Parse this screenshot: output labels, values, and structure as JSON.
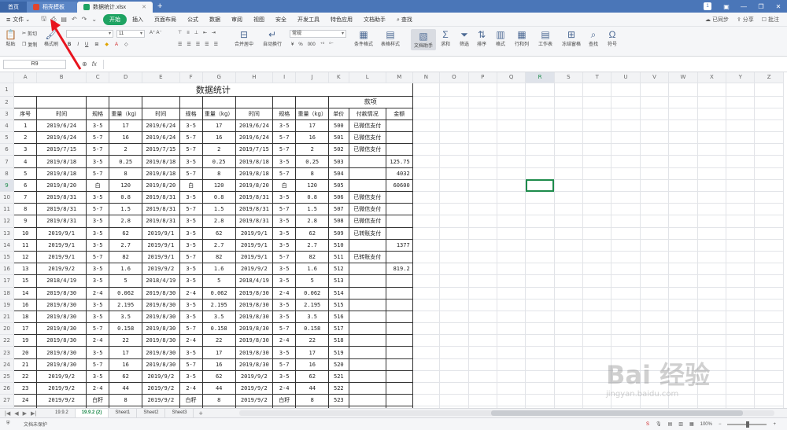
{
  "titlebar": {
    "home_tab": "首页",
    "template_tab": "稻壳模板",
    "file_tab": "数据统计.xlsx",
    "badge": "1"
  },
  "menubar": {
    "file_label": "文件",
    "items": [
      "开始",
      "插入",
      "页面布局",
      "公式",
      "数据",
      "审阅",
      "视图",
      "安全",
      "开发工具",
      "特色应用",
      "文档助手",
      "查找"
    ],
    "right": [
      "已同步",
      "分享",
      "批注"
    ]
  },
  "ribbon": {
    "cut": "剪切",
    "paste": "粘贴",
    "copy": "复制",
    "format_painter": "格式刷",
    "font_size": "11",
    "merge_center": "合并居中",
    "wrap": "自动换行",
    "number_format": "常规",
    "cond_format": "条件格式",
    "table_style": "表格样式",
    "doc_helper": "文档助手",
    "sum": "求和",
    "filter": "筛选",
    "sort": "排序",
    "format": "格式",
    "row_col": "行和列",
    "worksheet": "工作表",
    "freeze": "冻结窗格",
    "find": "查找",
    "symbol": "符号"
  },
  "formulabar": {
    "namebox": "R9",
    "fx": "fx"
  },
  "sheet": {
    "columns": [
      "A",
      "B",
      "C",
      "D",
      "E",
      "F",
      "G",
      "H",
      "I",
      "J",
      "K",
      "L",
      "M",
      "N",
      "O",
      "P",
      "Q",
      "R",
      "S",
      "T",
      "U",
      "V",
      "W",
      "X",
      "Y",
      "Z"
    ],
    "title": "数据统计",
    "kuanxiang": "款项",
    "headers": [
      "序号",
      "时间",
      "规格",
      "重量（kg）",
      "时间",
      "规格",
      "重量（kg）",
      "时间",
      "规格",
      "重量（kg）",
      "单价",
      "付款情况",
      "金额"
    ],
    "rows": [
      {
        "rn": "4",
        "c": [
          "1",
          "2019/6/24",
          "3-5",
          "17",
          "2019/6/24",
          "3-5",
          "17",
          "2019/6/24",
          "3-5",
          "17",
          "500",
          "已微信支付",
          ""
        ]
      },
      {
        "rn": "5",
        "c": [
          "2",
          "2019/6/24",
          "5-7",
          "16",
          "2019/6/24",
          "5-7",
          "16",
          "2019/6/24",
          "5-7",
          "16",
          "501",
          "已微信支付",
          ""
        ]
      },
      {
        "rn": "6",
        "c": [
          "3",
          "2019/7/15",
          "5-7",
          "2",
          "2019/7/15",
          "5-7",
          "2",
          "2019/7/15",
          "5-7",
          "2",
          "502",
          "已微信支付",
          ""
        ]
      },
      {
        "rn": "7",
        "c": [
          "4",
          "2019/8/18",
          "3-5",
          "0.25",
          "2019/8/18",
          "3-5",
          "0.25",
          "2019/8/18",
          "3-5",
          "0.25",
          "503",
          "",
          "125.75"
        ]
      },
      {
        "rn": "8",
        "c": [
          "5",
          "2019/8/18",
          "5-7",
          "8",
          "2019/8/18",
          "5-7",
          "8",
          "2019/8/18",
          "5-7",
          "8",
          "504",
          "",
          "4032"
        ]
      },
      {
        "rn": "9",
        "c": [
          "6",
          "2019/8/20",
          "白",
          "120",
          "2019/8/20",
          "白",
          "120",
          "2019/8/20",
          "白",
          "120",
          "505",
          "",
          "60600"
        ]
      },
      {
        "rn": "10",
        "c": [
          "7",
          "2019/8/31",
          "3-5",
          "0.8",
          "2019/8/31",
          "3-5",
          "0.8",
          "2019/8/31",
          "3-5",
          "0.8",
          "506",
          "已微信支付",
          ""
        ]
      },
      {
        "rn": "11",
        "c": [
          "8",
          "2019/8/31",
          "5-7",
          "1.5",
          "2019/8/31",
          "5-7",
          "1.5",
          "2019/8/31",
          "5-7",
          "1.5",
          "507",
          "已微信支付",
          ""
        ]
      },
      {
        "rn": "12",
        "c": [
          "9",
          "2019/8/31",
          "3-5",
          "2.8",
          "2019/8/31",
          "3-5",
          "2.8",
          "2019/8/31",
          "3-5",
          "2.8",
          "508",
          "已微信支付",
          ""
        ]
      },
      {
        "rn": "13",
        "c": [
          "10",
          "2019/9/1",
          "3-5",
          "62",
          "2019/9/1",
          "3-5",
          "62",
          "2019/9/1",
          "3-5",
          "62",
          "509",
          "已转账支付",
          ""
        ]
      },
      {
        "rn": "14",
        "c": [
          "11",
          "2019/9/1",
          "3-5",
          "2.7",
          "2019/9/1",
          "3-5",
          "2.7",
          "2019/9/1",
          "3-5",
          "2.7",
          "510",
          "",
          "1377"
        ]
      },
      {
        "rn": "15",
        "c": [
          "12",
          "2019/9/1",
          "5-7",
          "82",
          "2019/9/1",
          "5-7",
          "82",
          "2019/9/1",
          "5-7",
          "82",
          "511",
          "已转账支付",
          ""
        ]
      },
      {
        "rn": "16",
        "c": [
          "13",
          "2019/9/2",
          "3-5",
          "1.6",
          "2019/9/2",
          "3-5",
          "1.6",
          "2019/9/2",
          "3-5",
          "1.6",
          "512",
          "",
          "819.2"
        ]
      },
      {
        "rn": "17",
        "c": [
          "15",
          "2018/4/19",
          "3-5",
          "5",
          "2018/4/19",
          "3-5",
          "5",
          "2018/4/19",
          "3-5",
          "5",
          "513",
          "",
          ""
        ]
      },
      {
        "rn": "18",
        "c": [
          "14",
          "2019/8/30",
          "2-4",
          "0.062",
          "2019/8/30",
          "2-4",
          "0.062",
          "2019/8/30",
          "2-4",
          "0.062",
          "514",
          "",
          ""
        ]
      },
      {
        "rn": "19",
        "c": [
          "16",
          "2019/8/30",
          "3-5",
          "2.195",
          "2019/8/30",
          "3-5",
          "2.195",
          "2019/8/30",
          "3-5",
          "2.195",
          "515",
          "",
          ""
        ]
      },
      {
        "rn": "21",
        "c": [
          "18",
          "2019/8/30",
          "3-5",
          "3.5",
          "2019/8/30",
          "3-5",
          "3.5",
          "2019/8/30",
          "3-5",
          "3.5",
          "516",
          "",
          ""
        ]
      },
      {
        "rn": "20",
        "c": [
          "17",
          "2019/8/30",
          "5-7",
          "0.158",
          "2019/8/30",
          "5-7",
          "0.158",
          "2019/8/30",
          "5-7",
          "0.158",
          "517",
          "",
          ""
        ]
      },
      {
        "rn": "22",
        "c": [
          "19",
          "2019/8/30",
          "2-4",
          "22",
          "2019/8/30",
          "2-4",
          "22",
          "2019/8/30",
          "2-4",
          "22",
          "518",
          "",
          ""
        ]
      },
      {
        "rn": "23",
        "c": [
          "20",
          "2019/8/30",
          "3-5",
          "17",
          "2019/8/30",
          "3-5",
          "17",
          "2019/8/30",
          "3-5",
          "17",
          "519",
          "",
          ""
        ]
      },
      {
        "rn": "24",
        "c": [
          "21",
          "2019/8/30",
          "5-7",
          "16",
          "2019/8/30",
          "5-7",
          "16",
          "2019/8/30",
          "5-7",
          "16",
          "520",
          "",
          ""
        ]
      },
      {
        "rn": "25",
        "c": [
          "22",
          "2019/9/2",
          "3-5",
          "62",
          "2019/9/2",
          "3-5",
          "62",
          "2019/9/2",
          "3-5",
          "62",
          "521",
          "",
          ""
        ]
      },
      {
        "rn": "26",
        "c": [
          "23",
          "2019/9/2",
          "2-4",
          "44",
          "2019/9/2",
          "2-4",
          "44",
          "2019/9/2",
          "2-4",
          "44",
          "522",
          "",
          ""
        ]
      },
      {
        "rn": "27",
        "c": [
          "24",
          "2019/9/2",
          "白籽",
          "8",
          "2019/9/2",
          "白籽",
          "8",
          "2019/9/2",
          "白籽",
          "8",
          "523",
          "",
          ""
        ]
      },
      {
        "rn": "28",
        "c": [
          "25",
          "2019/9/3",
          "3-5",
          "2.9",
          "2019/9/3",
          "3-5",
          "2.9",
          "2019/9/3",
          "3-5",
          "2.9",
          "524",
          "",
          "1519.6"
        ]
      }
    ]
  },
  "sheet_tabs": [
    "19.9.2",
    "19.9.2 (2)",
    "Sheet1",
    "Sheet2",
    "Sheet3"
  ],
  "status": {
    "protect": "文档未保护",
    "zoom": "100%"
  },
  "watermark": {
    "main": "Bai 经验",
    "sub": "jingyan.baidu.com"
  }
}
